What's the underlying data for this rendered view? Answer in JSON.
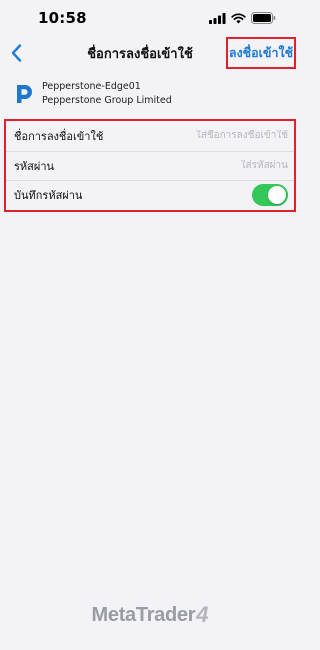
{
  "status_bar": {
    "time": "10:58"
  },
  "nav": {
    "title": "ชื่อการลงชื่อเข้าใช้",
    "login_label": "ลงชื่อเข้าใช้"
  },
  "server": {
    "name": "Pepperstone-Edge01",
    "company": "Pepperstone Group Limited"
  },
  "form": {
    "login_label": "ชื่อการลงชื่อเข้าใช้",
    "login_placeholder": "ใส่ชื่อการลงชื่อเข้าใช้",
    "password_label": "รหัสผ่าน",
    "password_placeholder": "ใส่รหัสผ่าน",
    "save_password_label": "บันทึกรหัสผ่าน",
    "save_password_on": true
  },
  "footer": {
    "brand": "MetaTrader",
    "version": "4"
  },
  "colors": {
    "accent_blue": "#1f7bd8",
    "highlight_red": "#e0202b",
    "toggle_green": "#34c759",
    "background": "#f2f2f7"
  }
}
